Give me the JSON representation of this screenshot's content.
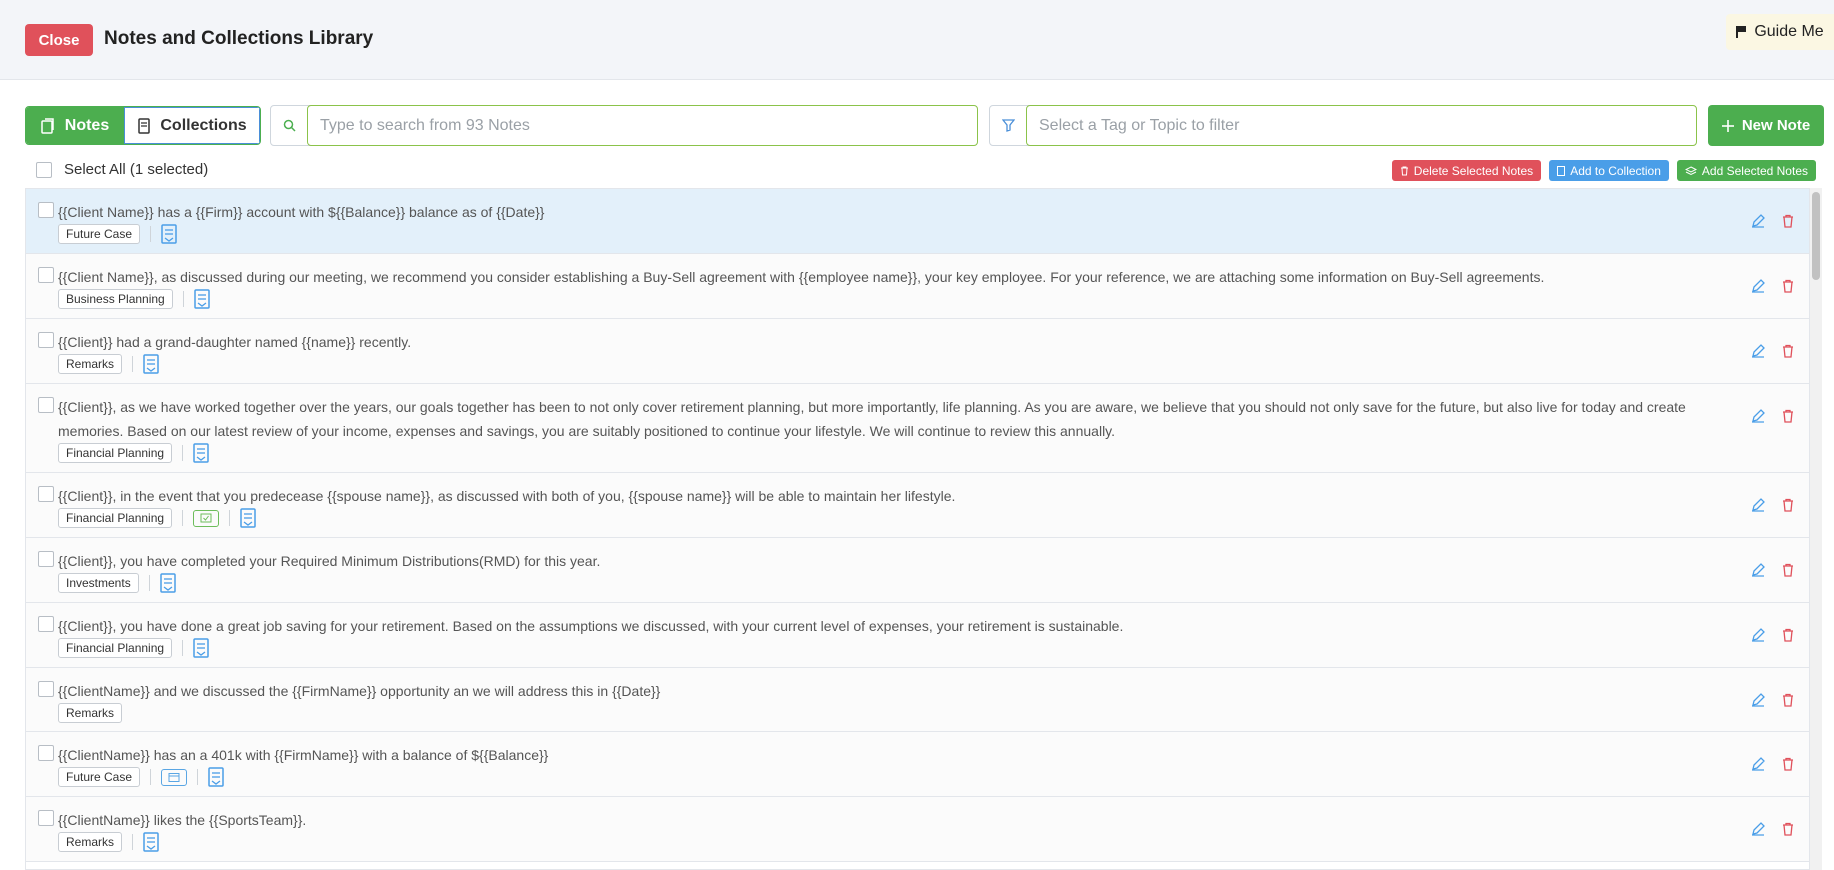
{
  "header": {
    "close_label": "Close",
    "title": "Notes and Collections Library",
    "guide_label": "Guide Me"
  },
  "toolbar": {
    "tab_notes": "Notes",
    "tab_collections": "Collections",
    "search_placeholder": "Type to search from 93 Notes",
    "filter_placeholder": "Select a Tag or Topic to filter",
    "new_note_label": "New Note"
  },
  "selection": {
    "select_all_label": "Select All (1 selected)",
    "delete_label": "Delete Selected Notes",
    "add_collection_label": "Add to Collection",
    "add_selected_label": "Add Selected Notes"
  },
  "notes": [
    {
      "text": "{{Client Name}} has a {{Firm}} account with ${{Balance}} balance as of {{Date}}",
      "tag": "Future Case"
    },
    {
      "text": "{{Client Name}}, as discussed during our meeting, we recommend you consider establishing a Buy-Sell agreement with {{employee name}}, your key employee. For your reference, we are attaching some information on Buy-Sell agreements.",
      "tag": "Business Planning"
    },
    {
      "text": "{{Client}} had a grand-daughter named {{name}} recently.",
      "tag": "Remarks"
    },
    {
      "text": "{{Client}}, as we have worked together over the years, our goals together has been to not only cover retirement planning, but more importantly, life planning. As you are aware, we believe that you should not only save for the future, but also live for today and create memories. Based on our latest review of your income, expenses and savings, you are suitably positioned to continue your lifestyle. We will continue to review this annually.",
      "tag": "Financial Planning"
    },
    {
      "text": "{{Client}}, in the event that you predecease {{spouse name}}, as discussed with both of you, {{spouse name}} will be able to maintain her lifestyle.",
      "tag": "Financial Planning"
    },
    {
      "text": "{{Client}}, you have completed your Required Minimum Distributions(RMD) for this year.",
      "tag": "Investments"
    },
    {
      "text": "{{Client}}, you have done a great job saving for your retirement. Based on the assumptions we discussed, with your current level of expenses, your retirement is sustainable.",
      "tag": "Financial Planning"
    },
    {
      "text": "{{ClientName}} and we discussed the {{FirmName}} opportunity an we will address this in {{Date}}",
      "tag": "Remarks"
    },
    {
      "text": "{{ClientName}} has an a 401k with {{FirmName}} with a balance of ${{Balance}}",
      "tag": "Future Case"
    },
    {
      "text": "{{ClientName}} likes the {{SportsTeam}}.",
      "tag": "Remarks"
    }
  ],
  "colors": {
    "primary_green": "#4cae4f",
    "danger_red": "#e0515b",
    "info_blue": "#4a9ee8",
    "selected_row": "#e3f0fa"
  }
}
